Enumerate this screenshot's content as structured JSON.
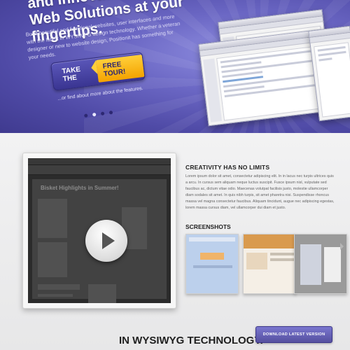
{
  "hero": {
    "title_line1": "and Innovative",
    "title_line2": "Web Solutions at your fingertips.",
    "description": "Build beautiful and functional websites, user interfaces and more with the latest in WYSIWYG design technology. Whether a veteran designer or new to website design, Positionit has something for your needs.",
    "cta_prefix": "TAKE THE",
    "cta_badge": "FREE TOUR!",
    "cta_subtext": "...or find about more about the features.",
    "slide_count": 4,
    "active_slide": 1
  },
  "video": {
    "headline": "Bisket Highlights in Summer!"
  },
  "creativity": {
    "heading": "CREATIVITY HAS NO LIMITS",
    "body": "Lorem ipsum dolor sit amet, consectetur adipiscing elit. In in lacus nec turpis ultrices quis a arcu. In cursus sem aliquam neque luctus suscipit. Fusce ipsum nisl, vulputate sed faucibus ac, dictum vitae odio. Maecenas volutpat facilisis justo, molestie ullamcorper diam sodales sit amet. In quis nibh turpis, sit amet pharetra nisi. Suspendisse rhoncus massa vel magna consectetur faucibus. Aliquam tincidunt, augue nec adipiscing egestas, lorem massa cursus diam, vel ullamcorper dui diam et justo."
  },
  "screenshots": {
    "heading": "SCREENSHOTS"
  },
  "bottom": {
    "title": "IN WYSIWYG TECHNOLOGY.",
    "download_label": "DOWNLOAD LATEST VERSION"
  },
  "colors": {
    "hero_purple": "#4f4aa6",
    "cta_yellow": "#f4a300",
    "button_purple": "#55509f"
  }
}
